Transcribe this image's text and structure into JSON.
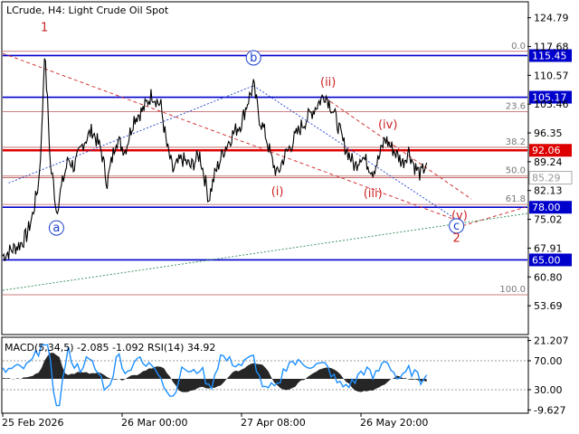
{
  "header": {
    "symbol_label": "LCrude, H4:  Light Crude Oil Spot"
  },
  "indicator": {
    "label": "MACD(5,34,5) -2.085 -1.092 RSI(14) 34.92"
  },
  "colors": {
    "background": "#ffffff",
    "price": "#000000",
    "blue_level": "#0000cc",
    "red_level": "#dd0000",
    "fib_line": "#bb5555",
    "wave_red": "#cc2222",
    "wave_blue": "#1a3fcc",
    "trend_green": "#2e8b57",
    "rsi": "#1e90ff",
    "macd": "#000000"
  },
  "chart_data": {
    "type": "line",
    "title": "",
    "price_axis": {
      "ylim": [
        46.8,
        128.5
      ],
      "ticks": [
        "124.79",
        "117.68",
        "110.57",
        "103.46",
        "96.35",
        "89.24",
        "82.13",
        "75.02",
        "67.91",
        "60.80",
        "53.69"
      ]
    },
    "time_axis": {
      "labels": [
        "25 Feb 2026",
        "26 Mar 00:00",
        "27 Apr 08:00",
        "26 May 20:00"
      ],
      "label_bars": [
        0,
        40,
        80,
        120
      ]
    },
    "indicator_axis": {
      "ticks": [
        "21.207",
        "70.00",
        "30.00",
        "-9.627"
      ]
    },
    "levels": [
      {
        "value": 115.45,
        "label": "115.45",
        "kind": "blue"
      },
      {
        "value": 105.17,
        "label": "105.17",
        "kind": "blue"
      },
      {
        "value": 92.06,
        "label": "92.06",
        "kind": "red"
      },
      {
        "value": 85.29,
        "label": "85.29",
        "kind": "gray"
      },
      {
        "value": 78.0,
        "label": "78.00",
        "kind": "blue"
      },
      {
        "value": 65.0,
        "label": "65.00",
        "kind": "blue"
      }
    ],
    "fib_levels": [
      {
        "label": "0.0",
        "value": 116.5
      },
      {
        "label": "23.6",
        "value": 101.6
      },
      {
        "label": "38.2",
        "value": 92.8
      },
      {
        "label": "50.0",
        "value": 85.7
      },
      {
        "label": "61.8",
        "value": 78.7
      },
      {
        "label": "100.0",
        "value": 56.4
      }
    ],
    "wave_labels": [
      {
        "text": "1",
        "bar": 14,
        "value": 121.5,
        "color": "red",
        "circle": false
      },
      {
        "text": "a",
        "bar": 18,
        "value": 72.0,
        "color": "blue",
        "circle": true
      },
      {
        "text": "b",
        "bar": 84,
        "value": 114.0,
        "color": "blue",
        "circle": true
      },
      {
        "text": "(ii)",
        "bar": 109,
        "value": 108.0,
        "color": "red",
        "circle": false
      },
      {
        "text": "(iv)",
        "bar": 129,
        "value": 97.5,
        "color": "red",
        "circle": false
      },
      {
        "text": "(i)",
        "bar": 92,
        "value": 81.0,
        "color": "red",
        "circle": false
      },
      {
        "text": "(iii)",
        "bar": 124,
        "value": 80.5,
        "color": "red",
        "circle": false
      },
      {
        "text": "(v)",
        "bar": 153,
        "value": 75.0,
        "color": "red",
        "circle": false
      },
      {
        "text": "c",
        "bar": 152,
        "value": 72.5,
        "color": "blue",
        "circle": true
      },
      {
        "text": "2",
        "bar": 152,
        "value": 69.5,
        "color": "red",
        "circle": false
      }
    ],
    "price_anchors": [
      [
        0,
        66
      ],
      [
        3,
        67.5
      ],
      [
        6,
        69
      ],
      [
        8,
        71
      ],
      [
        10,
        76
      ],
      [
        12,
        84
      ],
      [
        13,
        95
      ],
      [
        14,
        116.5
      ],
      [
        15,
        104
      ],
      [
        16,
        88
      ],
      [
        17,
        84
      ],
      [
        18,
        77
      ],
      [
        20,
        84
      ],
      [
        22,
        90
      ],
      [
        24,
        88
      ],
      [
        27,
        94
      ],
      [
        30,
        97
      ],
      [
        33,
        92
      ],
      [
        35,
        84
      ],
      [
        38,
        95
      ],
      [
        41,
        92
      ],
      [
        44,
        100
      ],
      [
        47,
        102
      ],
      [
        50,
        106
      ],
      [
        53,
        103
      ],
      [
        55,
        93
      ],
      [
        57,
        87
      ],
      [
        60,
        90
      ],
      [
        63,
        88
      ],
      [
        66,
        91
      ],
      [
        68,
        84
      ],
      [
        69,
        80
      ],
      [
        71,
        86
      ],
      [
        74,
        92
      ],
      [
        77,
        96
      ],
      [
        80,
        99
      ],
      [
        82,
        104
      ],
      [
        84,
        108
      ],
      [
        86,
        100
      ],
      [
        88,
        96
      ],
      [
        90,
        90
      ],
      [
        92,
        86
      ],
      [
        94,
        90
      ],
      [
        97,
        94
      ],
      [
        100,
        98
      ],
      [
        103,
        101
      ],
      [
        106,
        104
      ],
      [
        108,
        106
      ],
      [
        110,
        103
      ],
      [
        112,
        99
      ],
      [
        114,
        94
      ],
      [
        116,
        91
      ],
      [
        118,
        88
      ],
      [
        120,
        91
      ],
      [
        122,
        89
      ],
      [
        124,
        87
      ],
      [
        126,
        90
      ],
      [
        128,
        95
      ],
      [
        130,
        93
      ],
      [
        132,
        91
      ],
      [
        134,
        89
      ],
      [
        136,
        92
      ],
      [
        138,
        88
      ],
      [
        140,
        86
      ],
      [
        142,
        89
      ]
    ],
    "wave_lines": [
      {
        "from": [
          2,
          84
        ],
        "to": [
          84,
          108
        ],
        "color": "blue",
        "dash": "dotted"
      },
      {
        "from": [
          84,
          108
        ],
        "to": [
          154,
          74
        ],
        "color": "blue",
        "dash": "dotted"
      },
      {
        "from": [
          0,
          116
        ],
        "to": [
          155,
          74
        ],
        "color": "red",
        "dash": "dashed"
      },
      {
        "from": [
          108,
          105
        ],
        "to": [
          157,
          80
        ],
        "color": "red",
        "dash": "dashed"
      },
      {
        "from": [
          152,
          73
        ],
        "to": [
          175,
          78
        ],
        "color": "red",
        "dash": "dashed"
      },
      {
        "from": [
          0,
          57.5
        ],
        "to": [
          176,
          76.5
        ],
        "color": "green",
        "dash": "dotted"
      }
    ]
  }
}
